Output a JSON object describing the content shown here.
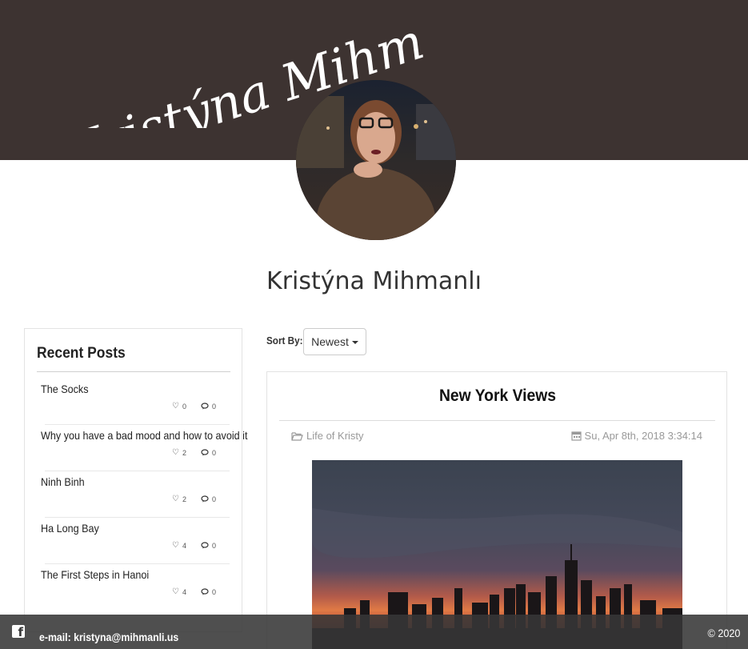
{
  "header": {
    "signature_text": "Kristýna Mihmanli",
    "avatar_alt": "Profile photo",
    "profile_name": "Kristýna Mihmanlı",
    "banner_color": "#3d3331"
  },
  "sidebar": {
    "title": "Recent Posts",
    "posts": [
      {
        "title": "The Socks",
        "likes": "0",
        "comments": "0"
      },
      {
        "title": "Why you have a bad mood and how to avoid it",
        "likes": "2",
        "comments": "0"
      },
      {
        "title": "Ninh Binh",
        "likes": "2",
        "comments": "0"
      },
      {
        "title": "Ha Long Bay",
        "likes": "4",
        "comments": "0"
      },
      {
        "title": "The First Steps in Hanoi",
        "likes": "4",
        "comments": "0"
      }
    ]
  },
  "sort": {
    "label": "Sort By:",
    "selected": "Newest"
  },
  "post": {
    "title": "New York Views",
    "category": "Life of Kristy",
    "date": "Su, Apr 8th, 2018 3:34:14"
  },
  "footer": {
    "email": "e-mail: kristyna@mihmanli.us",
    "copyright": "© 2020"
  }
}
